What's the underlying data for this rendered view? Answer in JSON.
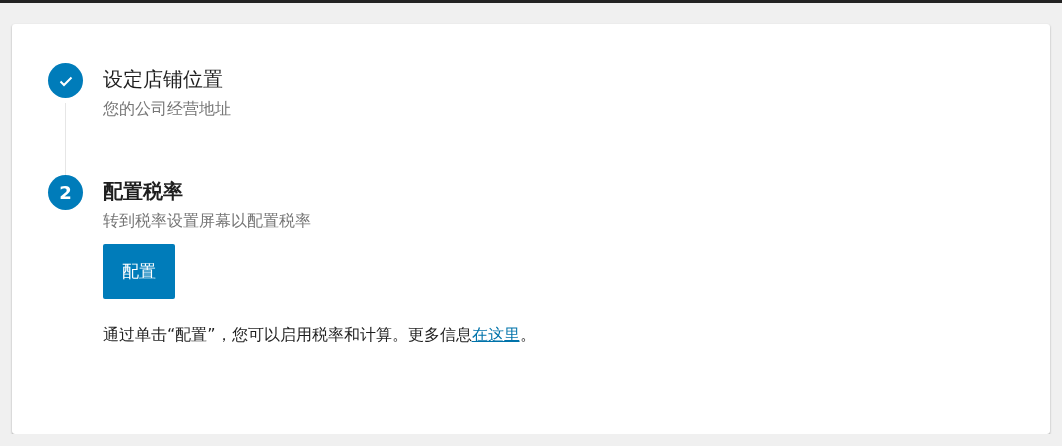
{
  "steps": [
    {
      "completed": true,
      "current": false,
      "title": "设定店铺位置",
      "description": "您的公司经营地址"
    },
    {
      "completed": false,
      "current": true,
      "number": "2",
      "title": "配置税率",
      "description": "转到税率设置屏幕以配置税率",
      "button": "配置",
      "note": {
        "before": "通过单击“配置”，您可以启用税率和计算。更多信息",
        "link": "在这里",
        "after": "。"
      }
    }
  ]
}
